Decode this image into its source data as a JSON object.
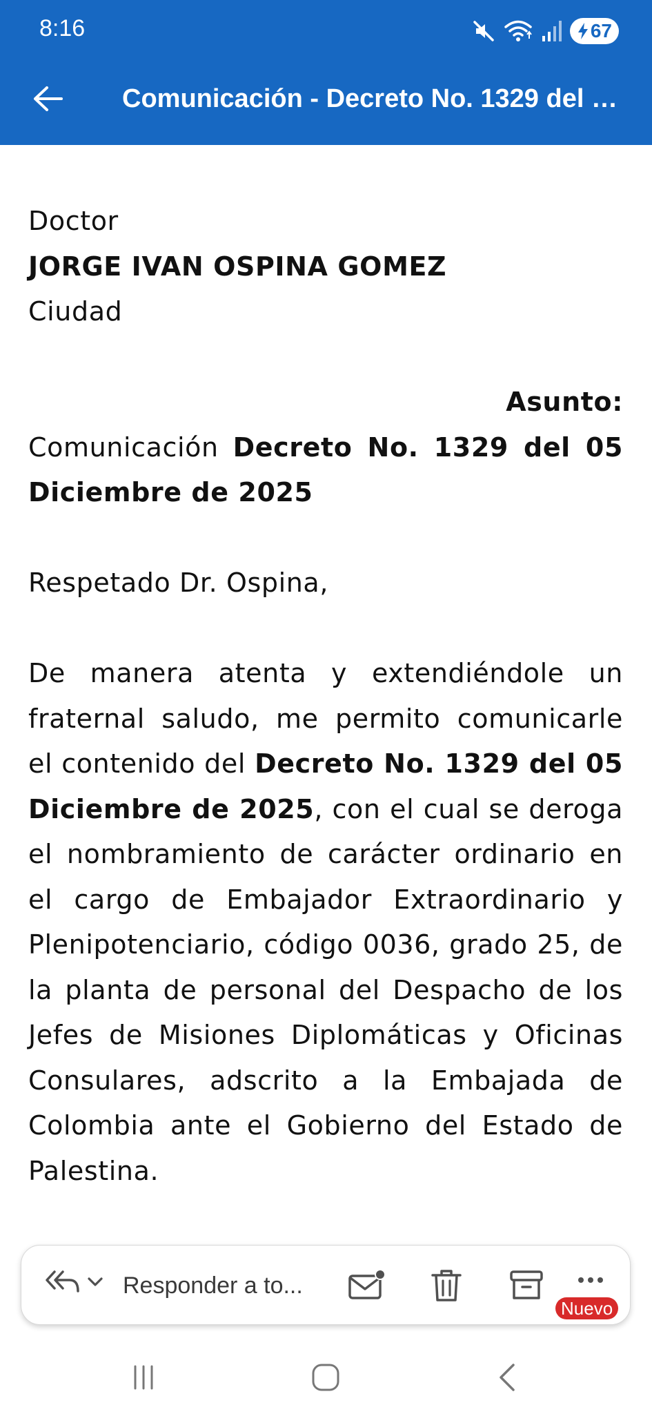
{
  "status_bar": {
    "time": "8:16",
    "battery": "67",
    "icons": [
      "mute-icon",
      "wifi-icon",
      "signal-icon",
      "battery-charging-icon"
    ]
  },
  "header": {
    "back_icon": "back-arrow-icon",
    "subject": "Comunicación - Decreto No. 1329 del 0..."
  },
  "email": {
    "salutation_title": "Doctor",
    "recipient_name": "JORGE IVAN OSPINA GOMEZ",
    "recipient_city": "Ciudad",
    "subject_label": "Asunto:",
    "subject_prefix": "Comunicación",
    "subject_bold": "Decreto No. 1329 del 05 Diciembre de 2025",
    "greeting": "Respetado Dr. Ospina,",
    "para_intro": "De manera atenta y extendiéndole un fraternal saludo, me permito comunicarle el contenido del",
    "para_decree": "Decreto No. 1329 del 05 Diciembre de 2025",
    "para_rest": ", con el cual se deroga el nombramiento de carácter ordinario en el cargo de Embajador Extraordinario y Plenipotenciario, código 0036, grado 25, de la planta de personal del Despacho de los Jefes de Misiones Diplomáticas y Oficinas Consulares, adscrito a la Embajada de Colombia ante el Gobierno del Estado de Palestina."
  },
  "action_bar": {
    "reply_label": "Responder a to...",
    "reply_icon": "reply-all-icon",
    "dropdown_icon": "chevron-down-icon",
    "mark_unread_icon": "mark-unread-icon",
    "delete_icon": "trash-icon",
    "archive_icon": "archive-icon",
    "more_icon": "more-icon",
    "badge": "Nuevo"
  },
  "nav_bar": {
    "icons": [
      "recent-apps-icon",
      "home-icon",
      "back-icon"
    ]
  },
  "colors": {
    "header_bg": "#1768c2",
    "badge_bg": "#d82a2a"
  }
}
